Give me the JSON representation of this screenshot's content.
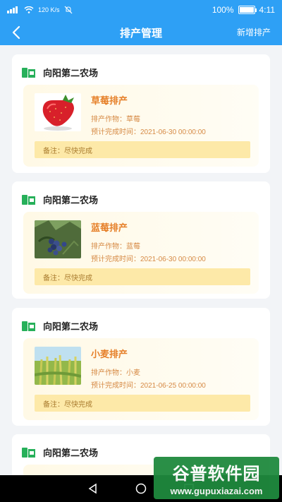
{
  "status_bar": {
    "network_speed": "120 K/s",
    "battery_percent": "100%",
    "battery_level": 1.0,
    "time": "4:11"
  },
  "nav": {
    "title": "排产管理",
    "action_label": "新增排产"
  },
  "cards": [
    {
      "farm": "向阳第二农场",
      "title": "草莓排产",
      "crop_label": "排产作物：草莓",
      "date_label": "预计完成时间：2021-06-30 00:00:00",
      "note_label": "备注：尽快完成",
      "image": "strawberry"
    },
    {
      "farm": "向阳第二农场",
      "title": "蓝莓排产",
      "crop_label": "排产作物：蓝莓",
      "date_label": "预计完成时间：2021-06-30 00:00:00",
      "note_label": "备注：尽快完成",
      "image": "blueberry"
    },
    {
      "farm": "向阳第二农场",
      "title": "小麦排产",
      "crop_label": "排产作物：小麦",
      "date_label": "预计完成时间：2021-06-25 00:00:00",
      "note_label": "备注：尽快完成",
      "image": "wheat"
    },
    {
      "farm": "向阳第二农场"
    }
  ],
  "watermark": {
    "brand": "谷普软件园",
    "url": "www.gupuxiazai.com"
  },
  "colors": {
    "primary": "#2ea0f5",
    "farm_icon": "#27b05a",
    "title_orange": "#e6802a",
    "note_bg": "#fde9a8"
  }
}
